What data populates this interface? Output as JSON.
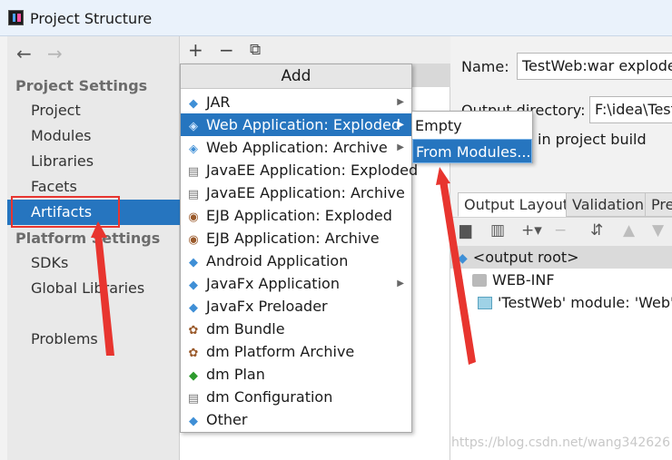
{
  "window": {
    "title": "Project Structure"
  },
  "nav": {
    "back": "←",
    "forward": "→"
  },
  "sidebar": {
    "project_settings_header": "Project Settings",
    "project_settings_items": [
      "Project",
      "Modules",
      "Libraries",
      "Facets",
      "Artifacts"
    ],
    "platform_settings_header": "Platform Settings",
    "platform_settings_items": [
      "SDKs",
      "Global Libraries"
    ],
    "problems": "Problems",
    "selected": "Artifacts"
  },
  "middle_toolbar": {
    "add": "+",
    "remove": "−",
    "copy": "⧉"
  },
  "add_menu": {
    "title": "Add",
    "items": [
      {
        "label": "JAR",
        "icon": "artifact-diamond-icon",
        "has_submenu": true
      },
      {
        "label": "Web Application: Exploded",
        "icon": "web-app-icon",
        "has_submenu": true,
        "highlighted": true
      },
      {
        "label": "Web Application: Archive",
        "icon": "web-app-icon",
        "has_submenu": true
      },
      {
        "label": "JavaEE Application: Exploded",
        "icon": "javaee-icon",
        "has_submenu": false
      },
      {
        "label": "JavaEE Application: Archive",
        "icon": "javaee-icon",
        "has_submenu": false
      },
      {
        "label": "EJB Application: Exploded",
        "icon": "ejb-icon",
        "has_submenu": false
      },
      {
        "label": "EJB Application: Archive",
        "icon": "ejb-icon",
        "has_submenu": false
      },
      {
        "label": "Android Application",
        "icon": "android-icon",
        "has_submenu": false
      },
      {
        "label": "JavaFx Application",
        "icon": "javafx-icon",
        "has_submenu": true
      },
      {
        "label": "JavaFx Preloader",
        "icon": "javafx-icon",
        "has_submenu": false
      },
      {
        "label": "dm Bundle",
        "icon": "dm-bundle-icon",
        "has_submenu": false
      },
      {
        "label": "dm Platform Archive",
        "icon": "dm-archive-icon",
        "has_submenu": false
      },
      {
        "label": "dm Plan",
        "icon": "dm-plan-icon",
        "has_submenu": false
      },
      {
        "label": "dm Configuration",
        "icon": "dm-config-icon",
        "has_submenu": false
      },
      {
        "label": "Other",
        "icon": "artifact-diamond-icon",
        "has_submenu": false
      }
    ]
  },
  "submenu": {
    "items": [
      "Empty",
      "From Modules..."
    ],
    "highlighted": "From Modules..."
  },
  "artifact": {
    "name_label": "Name:",
    "name_value": "TestWeb:war exploded",
    "output_dir_label": "Output directory:",
    "output_dir_value": "F:\\idea\\TestWeb",
    "include_text": "in project build",
    "tabs": [
      "Output Layout",
      "Validation",
      "Pre"
    ],
    "active_tab": "Output Layout",
    "tree": [
      {
        "label": "<output root>",
        "icon": "output-root-icon",
        "selected": true
      },
      {
        "label": "WEB-INF",
        "icon": "folder-icon",
        "expandable": true
      },
      {
        "label": "'TestWeb' module: 'Web'",
        "icon": "module-icon"
      }
    ]
  },
  "watermark": "https://blog.csdn.net/wang342626",
  "colors": {
    "selection": "#2675bf",
    "annotation": "#e8352f"
  }
}
